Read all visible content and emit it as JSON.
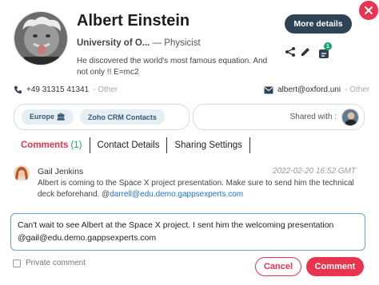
{
  "profile": {
    "name": "Albert Einstein",
    "organization": "University of O...",
    "separator": "—",
    "role": "Physicist",
    "bio": "He discovered the world's most famous equation. And not only !! E=mc2"
  },
  "actions": {
    "more_details": "More details",
    "notification_count": "1"
  },
  "contact": {
    "phone": "+49 31315 41341",
    "phone_label": "- Other",
    "email": "albert@oxford.uni",
    "email_label": "- Other"
  },
  "tags": [
    "Europe 🏛",
    "Zoho CRM Contacts"
  ],
  "shared": {
    "label": "Shared with :"
  },
  "tabs": [
    {
      "label": "Comments",
      "count": "(1)",
      "active": true
    },
    {
      "label": "Contact Details"
    },
    {
      "label": "Sharing Settings"
    }
  ],
  "comment": {
    "author": "Gail Jenkins",
    "date": "2022-02-20 16:52 GMT",
    "text_before": "Albert is coming to the Space X project presentation. Make sure to send him the technical deck beforehand. @",
    "mention": "darrell@edu.demo.gappsexperts.com"
  },
  "editor": {
    "value": "Can't wait to see Albert at the Space X project. I sent him the welcoming presentation @gail@edu.demo.gappsexperts.com"
  },
  "footer": {
    "private_label": "Private comment",
    "cancel": "Cancel",
    "submit": "Comment"
  },
  "colors": {
    "accent": "#e8344e",
    "primary_dark": "#2f4356",
    "success": "#1aa36f",
    "link": "#1976d2"
  },
  "icons": [
    "close-icon",
    "share-icon",
    "edit-icon",
    "tasks-icon",
    "phone-icon",
    "mail-icon"
  ]
}
